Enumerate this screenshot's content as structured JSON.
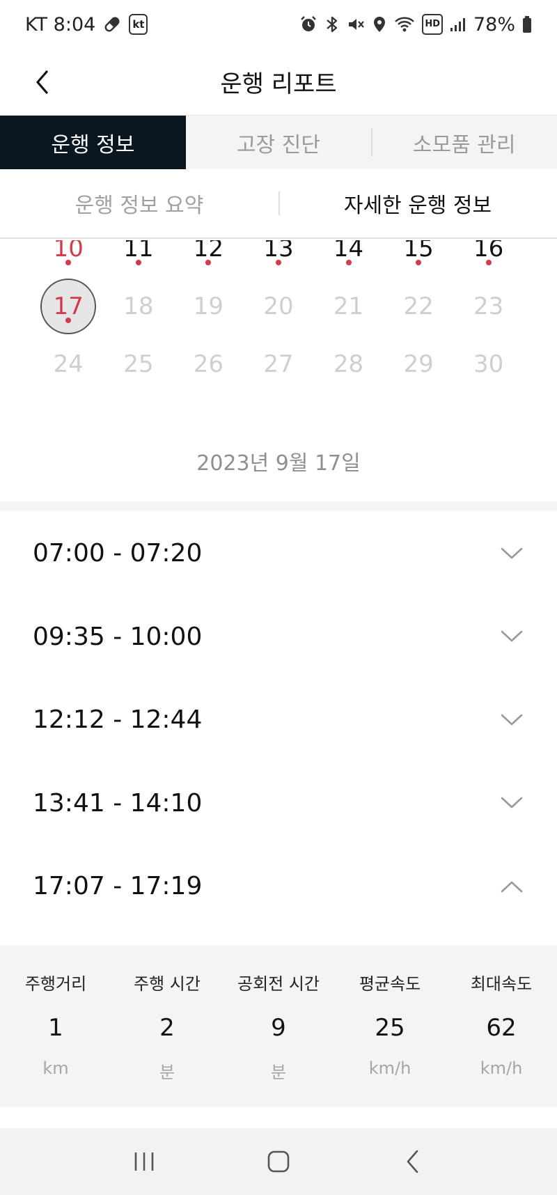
{
  "status_bar": {
    "carrier_time": "KT 8:04",
    "carrier_badge": "kt",
    "hd_badge": "HD",
    "battery": "78%",
    "icons": [
      "pill-icon",
      "kt-icon",
      "alarm-icon",
      "bluetooth-icon",
      "mute-icon",
      "location-icon",
      "wifi-icon",
      "hd-voice-icon",
      "signal-icon",
      "battery-icon"
    ]
  },
  "header": {
    "title": "운행 리포트",
    "back_icon": "chevron-left-icon"
  },
  "main_tabs": [
    {
      "label": "운행 정보",
      "active": true
    },
    {
      "label": "고장 진단",
      "active": false
    },
    {
      "label": "소모품 관리",
      "active": false
    }
  ],
  "sub_tabs": [
    {
      "label": "운행 정보 요약",
      "active": false
    },
    {
      "label": "자세한 운행 정보",
      "active": true
    }
  ],
  "calendar": {
    "rows": [
      [
        {
          "day": "10",
          "state": "sunday",
          "dot": true
        },
        {
          "day": "11",
          "state": "past",
          "dot": true
        },
        {
          "day": "12",
          "state": "past",
          "dot": true
        },
        {
          "day": "13",
          "state": "past",
          "dot": true
        },
        {
          "day": "14",
          "state": "past",
          "dot": true
        },
        {
          "day": "15",
          "state": "past",
          "dot": true
        },
        {
          "day": "16",
          "state": "past",
          "dot": true
        }
      ],
      [
        {
          "day": "17",
          "state": "selected",
          "dot": true
        },
        {
          "day": "18",
          "state": "future",
          "dot": false
        },
        {
          "day": "19",
          "state": "future",
          "dot": false
        },
        {
          "day": "20",
          "state": "future",
          "dot": false
        },
        {
          "day": "21",
          "state": "future",
          "dot": false
        },
        {
          "day": "22",
          "state": "future",
          "dot": false
        },
        {
          "day": "23",
          "state": "future",
          "dot": false
        }
      ],
      [
        {
          "day": "24",
          "state": "future",
          "dot": false
        },
        {
          "day": "25",
          "state": "future",
          "dot": false
        },
        {
          "day": "26",
          "state": "future",
          "dot": false
        },
        {
          "day": "27",
          "state": "future",
          "dot": false
        },
        {
          "day": "28",
          "state": "future",
          "dot": false
        },
        {
          "day": "29",
          "state": "future",
          "dot": false
        },
        {
          "day": "30",
          "state": "future",
          "dot": false
        }
      ]
    ],
    "accent_color": "#d23b4a"
  },
  "selected_date": "2023년 9월 17일",
  "trips": [
    {
      "time": "07:00 - 07:20",
      "expanded": false
    },
    {
      "time": "09:35 - 10:00",
      "expanded": false
    },
    {
      "time": "12:12 - 12:44",
      "expanded": false
    },
    {
      "time": "13:41 - 14:10",
      "expanded": false
    },
    {
      "time": "17:07 - 17:19",
      "expanded": true
    }
  ],
  "trip_detail": {
    "stats": [
      {
        "label": "주행거리",
        "value": "1",
        "unit": "km"
      },
      {
        "label": "주행 시간",
        "value": "2",
        "unit": "분"
      },
      {
        "label": "공회전 시간",
        "value": "9",
        "unit": "분"
      },
      {
        "label": "평균속도",
        "value": "25",
        "unit": "km/h"
      },
      {
        "label": "최대속도",
        "value": "62",
        "unit": "km/h"
      }
    ]
  },
  "nav_bar": {
    "buttons": [
      "recent-apps-icon",
      "home-icon",
      "back-icon"
    ]
  },
  "colors": {
    "active_tab_bg": "#0b1720",
    "panel_bg": "#f4f4f4",
    "accent": "#d23b4a"
  }
}
